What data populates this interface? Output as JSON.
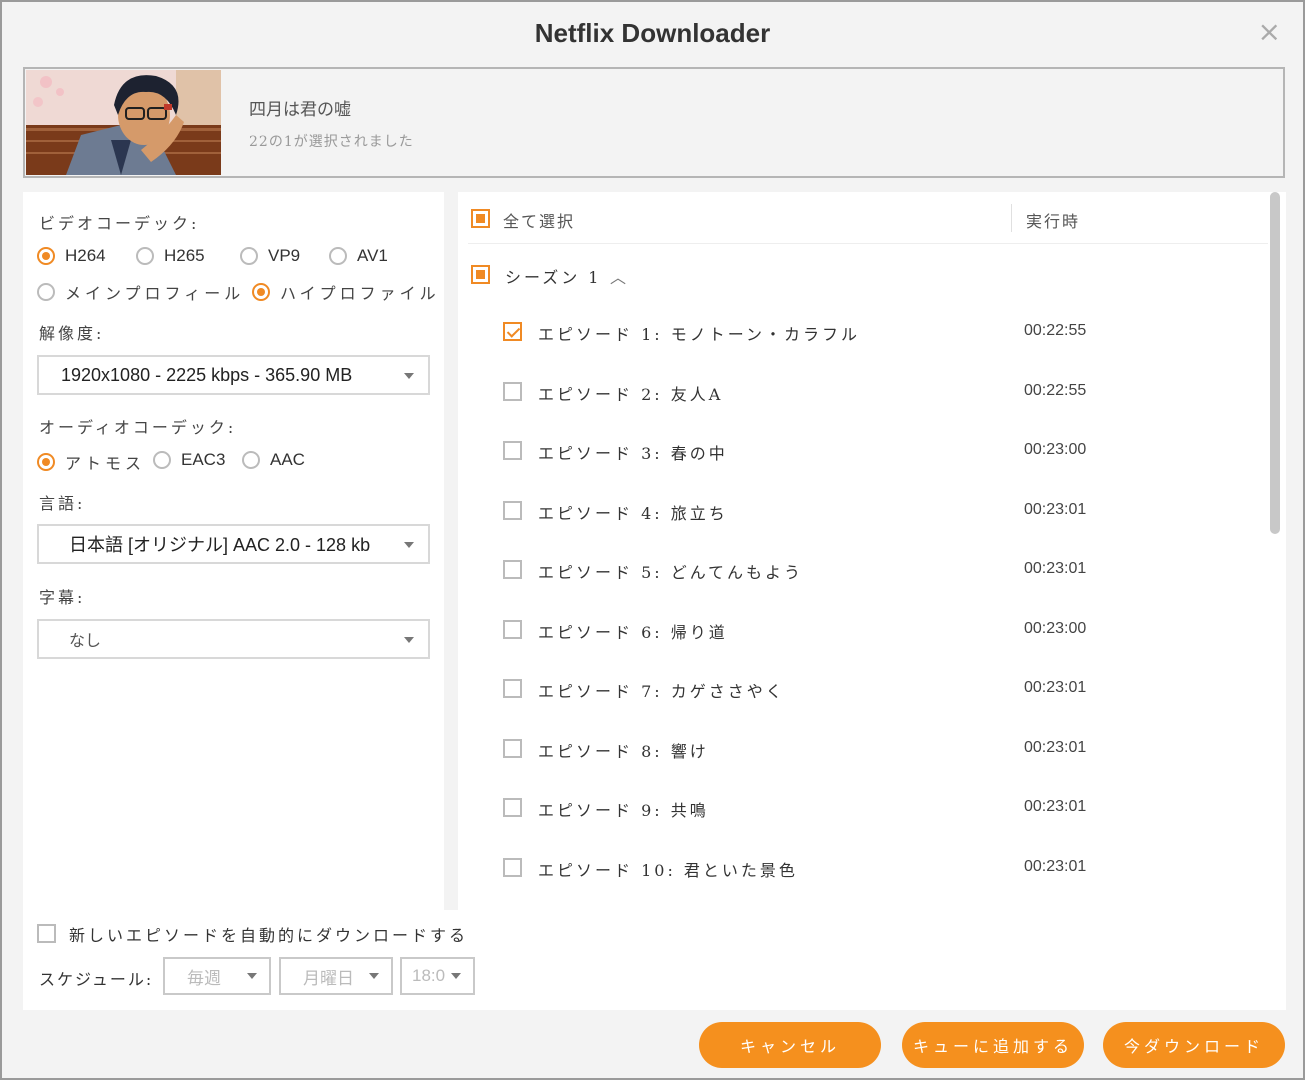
{
  "window": {
    "title": "Netflix Downloader",
    "close_icon": "×"
  },
  "show": {
    "title": "四月は君の嘘",
    "selection": "22の1が選択されました"
  },
  "video": {
    "label": "ビデオコーデック:",
    "codecs": [
      "H264",
      "H265",
      "VP9",
      "AV1"
    ],
    "selected_codec": "H264",
    "profiles": [
      "メインプロフィール",
      "ハイプロファイル"
    ],
    "selected_profile": "ハイプロファイル"
  },
  "resolution": {
    "label": "解像度:",
    "value": "1920x1080 - 2225 kbps - 365.90 MB"
  },
  "audio": {
    "label": "オーディオコーデック:",
    "codecs": [
      "アトモス",
      "EAC3",
      "AAC"
    ],
    "selected_codec": "アトモス"
  },
  "language": {
    "label": "言語:",
    "value": "日本語 [オリジナル] AAC 2.0 - 128 kb"
  },
  "subtitle": {
    "label": "字幕:",
    "value": "なし"
  },
  "list": {
    "select_all": "全て選択",
    "runtime_header": "実行時",
    "season": "シーズン 1",
    "episodes": [
      {
        "label": "エピソード 1: モノトーン・カラフル",
        "time": "00:22:55",
        "checked": true
      },
      {
        "label": "エピソード 2: 友人A",
        "time": "00:22:55",
        "checked": false
      },
      {
        "label": "エピソード 3: 春の中",
        "time": "00:23:00",
        "checked": false
      },
      {
        "label": "エピソード 4: 旅立ち",
        "time": "00:23:01",
        "checked": false
      },
      {
        "label": "エピソード 5: どんてんもよう",
        "time": "00:23:01",
        "checked": false
      },
      {
        "label": "エピソード 6: 帰り道",
        "time": "00:23:00",
        "checked": false
      },
      {
        "label": "エピソード 7: カゲささやく",
        "time": "00:23:01",
        "checked": false
      },
      {
        "label": "エピソード 8: 響け",
        "time": "00:23:01",
        "checked": false
      },
      {
        "label": "エピソード 9: 共鳴",
        "time": "00:23:01",
        "checked": false
      },
      {
        "label": "エピソード 10: 君といた景色",
        "time": "00:23:01",
        "checked": false
      }
    ]
  },
  "auto": {
    "label": "新しいエピソードを自動的にダウンロードする",
    "schedule_label": "スケジュール:",
    "frequency": "毎週",
    "day": "月曜日",
    "time": "18:0"
  },
  "buttons": {
    "cancel": "キャンセル",
    "queue": "キューに追加する",
    "download": "今ダウンロード"
  },
  "colors": {
    "accent": "#f5901e",
    "background": "#f3f3f3"
  }
}
